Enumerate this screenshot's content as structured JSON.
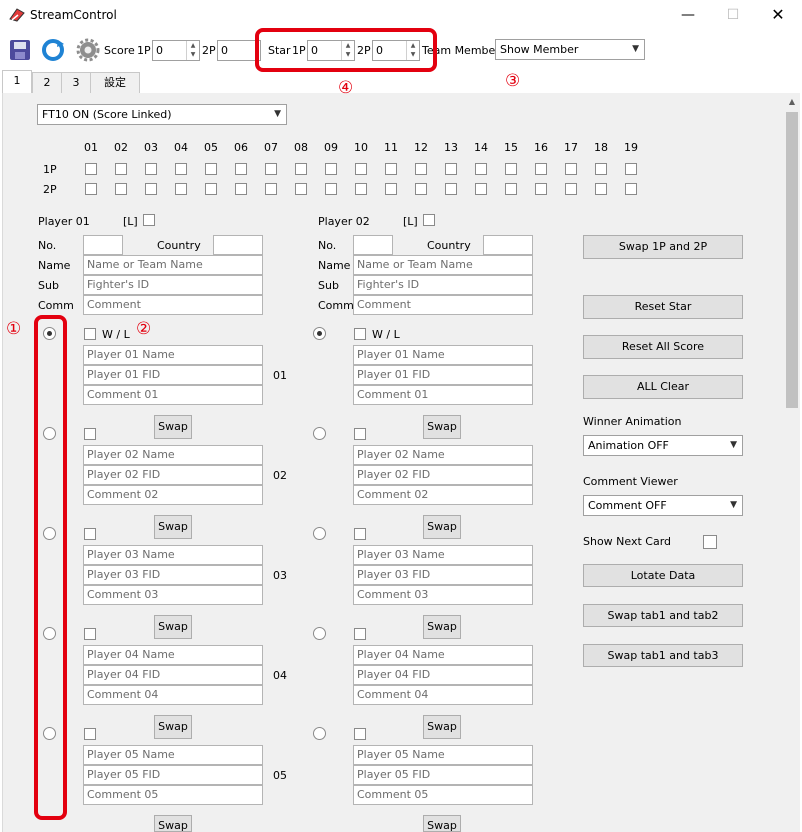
{
  "window": {
    "title": "StreamControl"
  },
  "toolbar": {
    "score_label": "Score",
    "p1_label": "1P",
    "p2_label": "2P",
    "score_1p": "0",
    "score_2p": "0",
    "star_label": "Star",
    "star_1p": "0",
    "star_2p": "0",
    "team_member_label": "Team Member",
    "team_member_value": "Show Member"
  },
  "tabs": [
    "1",
    "2",
    "3",
    "設定"
  ],
  "mode_dropdown": "FT10 ON (Score Linked)",
  "win_grid": {
    "columns": [
      "01",
      "02",
      "03",
      "04",
      "05",
      "06",
      "07",
      "08",
      "09",
      "10",
      "11",
      "12",
      "13",
      "14",
      "15",
      "16",
      "17",
      "18",
      "19"
    ],
    "rows": [
      "1P",
      "2P"
    ]
  },
  "player1": {
    "title": "Player 01",
    "l_label": "[L]",
    "no_label": "No.",
    "country_label": "Country",
    "name_label": "Name",
    "sub_label": "Sub",
    "comm_label": "Comm",
    "name_placeholder": "Name or Team Name",
    "sub_placeholder": "Fighter's ID",
    "comm_placeholder": "Comment"
  },
  "player2": {
    "title": "Player 02",
    "l_label": "[L]",
    "no_label": "No.",
    "country_label": "Country",
    "name_label": "Name",
    "sub_label": "Sub",
    "comm_label": "Comm",
    "name_placeholder": "Name or Team Name",
    "sub_placeholder": "Fighter's ID",
    "comm_placeholder": "Comment"
  },
  "wl_label": "W / L",
  "swap_label": "Swap",
  "members": [
    {
      "num": "01",
      "name": "Player 01 Name",
      "fid": "Player 01 FID",
      "comment": "Comment 01"
    },
    {
      "num": "02",
      "name": "Player 02 Name",
      "fid": "Player 02 FID",
      "comment": "Comment 02"
    },
    {
      "num": "03",
      "name": "Player 03 Name",
      "fid": "Player 03 FID",
      "comment": "Comment 03"
    },
    {
      "num": "04",
      "name": "Player 04 Name",
      "fid": "Player 04 FID",
      "comment": "Comment 04"
    },
    {
      "num": "05",
      "name": "Player 05 Name",
      "fid": "Player 05 FID",
      "comment": "Comment 05"
    }
  ],
  "right_panel": {
    "swap_players": "Swap 1P and 2P",
    "reset_star": "Reset Star",
    "reset_all_score": "Reset All Score",
    "all_clear": "ALL Clear",
    "winner_animation_label": "Winner Animation",
    "winner_animation_value": "Animation OFF",
    "comment_viewer_label": "Comment Viewer",
    "comment_viewer_value": "Comment OFF",
    "show_next_card_label": "Show Next Card",
    "lotate_data": "Lotate Data",
    "swap_tab1_tab2": "Swap tab1 and tab2",
    "swap_tab1_tab3": "Swap tab1 and tab3"
  },
  "annotations": [
    "①",
    "②",
    "③",
    "④"
  ],
  "colors": {
    "highlight": "#e3000f",
    "panel_bg": "#f0f0f0"
  }
}
